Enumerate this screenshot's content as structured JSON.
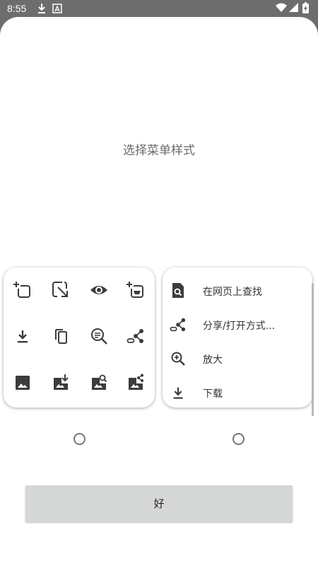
{
  "status_bar": {
    "time": "8:55",
    "icons": [
      "download-icon",
      "a-badge-icon",
      "wifi-icon",
      "signal-icon",
      "battery-icon"
    ]
  },
  "dialog": {
    "title": "选择菜单样式",
    "grid_style_icons": [
      "new-tab-icon",
      "open-in-icon",
      "preview-eye-icon",
      "incognito-tab-icon",
      "download-icon",
      "copy-icon",
      "find-in-text-icon",
      "share-link-icon",
      "image-icon",
      "image-download-icon",
      "image-search-icon",
      "image-share-icon"
    ],
    "list_style_items": [
      {
        "icon": "find-in-page-icon",
        "label": "在网页上查找"
      },
      {
        "icon": "share-link-icon",
        "label": "分享/打开方式..."
      },
      {
        "icon": "zoom-in-icon",
        "label": "放大"
      },
      {
        "icon": "download-icon",
        "label": "下载"
      }
    ],
    "options": [
      {
        "name": "grid-style",
        "selected": false
      },
      {
        "name": "list-style",
        "selected": false
      }
    ],
    "ok_label": "好"
  },
  "colors": {
    "scrim": "#6d6d6d",
    "sheet": "#ffffff",
    "button": "#d6d7d7",
    "icon": "#3c3c3c"
  }
}
